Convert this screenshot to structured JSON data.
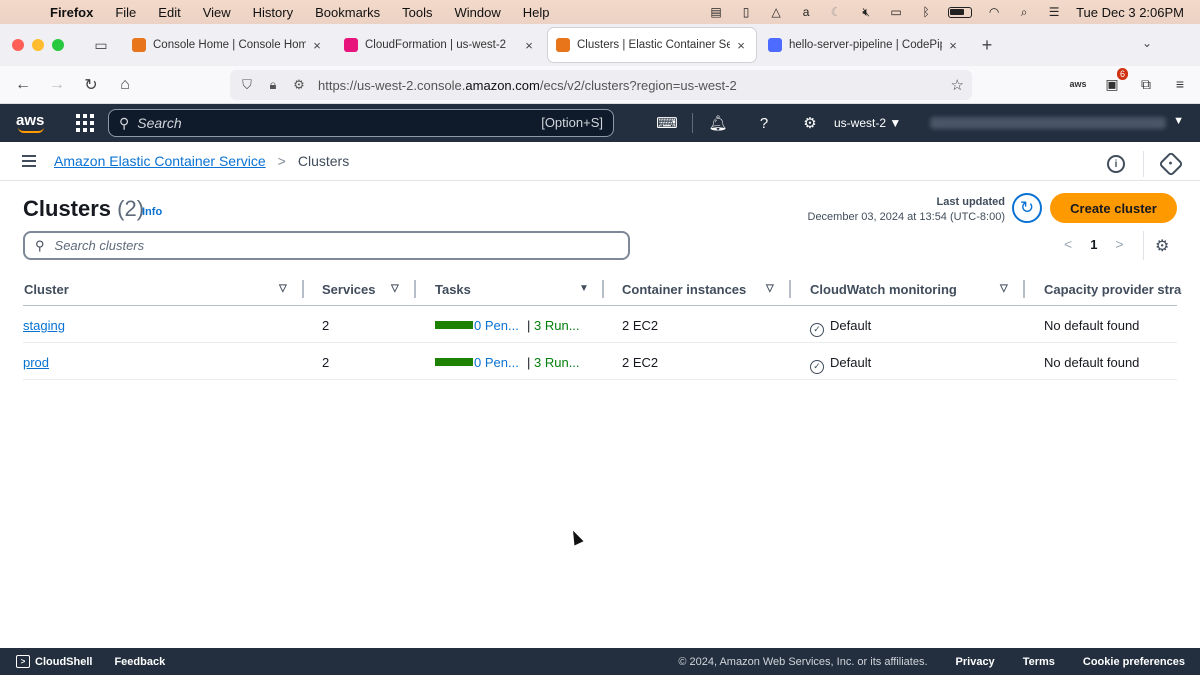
{
  "macbar": {
    "app": "Firefox",
    "menus": [
      "File",
      "Edit",
      "View",
      "History",
      "Bookmarks",
      "Tools",
      "Window",
      "Help"
    ],
    "clock": "Tue Dec 3  2:06PM"
  },
  "tabs": [
    {
      "title": "Console Home | Console Home",
      "color": "#e8751a",
      "active": false
    },
    {
      "title": "CloudFormation | us-west-2",
      "color": "#e7157b",
      "active": false
    },
    {
      "title": "Clusters | Elastic Container Serv",
      "color": "#e8751a",
      "active": true
    },
    {
      "title": "hello-server-pipeline | CodePipe",
      "color": "#4d6bfe",
      "active": false
    }
  ],
  "url": {
    "prefix": "https://us-west-2.console.",
    "domain": "amazon.com",
    "suffix": "/ecs/v2/clusters?region=us-west-2"
  },
  "extension_badge": "6",
  "aws": {
    "logo": "aws",
    "search_placeholder": "Search",
    "search_shortcut": "[Option+S]",
    "region": "us-west-2 ▼"
  },
  "breadcrumb": {
    "service": "Amazon Elastic Container Service",
    "separator": ">",
    "current": "Clusters"
  },
  "header": {
    "title": "Clusters",
    "count": "(2)",
    "info": "Info",
    "last_updated_label": "Last updated",
    "last_updated_value": "December 03, 2024 at 13:54 (UTC-8:00)",
    "create_button": "Create cluster"
  },
  "filter": {
    "placeholder": "Search clusters"
  },
  "pagination": {
    "page": "1",
    "prev": "<",
    "next": ">"
  },
  "table": {
    "columns": [
      "Cluster",
      "Services",
      "Tasks",
      "Container instances",
      "CloudWatch monitoring",
      "Capacity provider stra"
    ],
    "rows": [
      {
        "cluster": "staging",
        "services": "2",
        "pending": "0 Pen...",
        "running": "3 Run...",
        "instances": "2 EC2",
        "monitoring": "Default",
        "capacity": "No default found"
      },
      {
        "cluster": "prod",
        "services": "2",
        "pending": "0 Pen...",
        "running": "3 Run...",
        "instances": "2 EC2",
        "monitoring": "Default",
        "capacity": "No default found"
      }
    ]
  },
  "footer": {
    "cloudshell": "CloudShell",
    "feedback": "Feedback",
    "copyright": "© 2024, Amazon Web Services, Inc. or its affiliates.",
    "privacy": "Privacy",
    "terms": "Terms",
    "cookies": "Cookie preferences"
  }
}
